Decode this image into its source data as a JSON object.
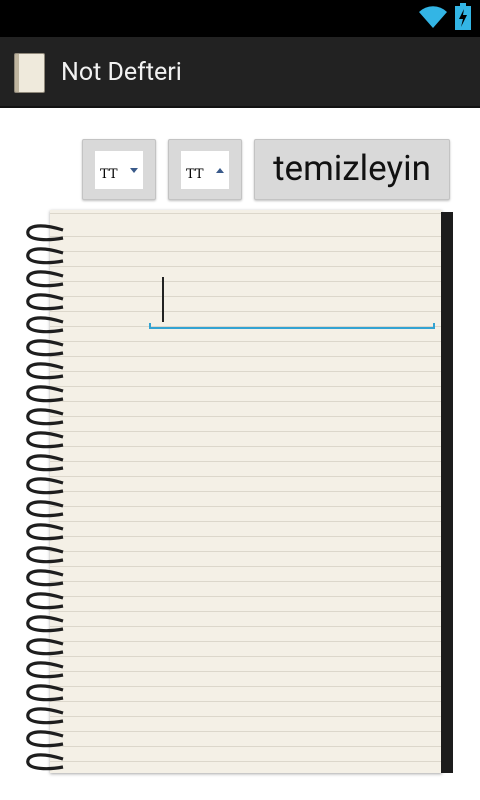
{
  "app": {
    "title": "Not Defteri"
  },
  "toolbar": {
    "font_decrease": {
      "icon": "text-size-decrease-icon",
      "glyph": "TT"
    },
    "font_increase": {
      "icon": "text-size-increase-icon",
      "glyph": "TT"
    },
    "clear_label": "temizleyin"
  },
  "editor": {
    "value": ""
  },
  "colors": {
    "status_bar": "#000000",
    "action_bar": "#222222",
    "accent": "#33a3d2",
    "button": "#d9d9d9",
    "paper": "#f4f0e6"
  }
}
